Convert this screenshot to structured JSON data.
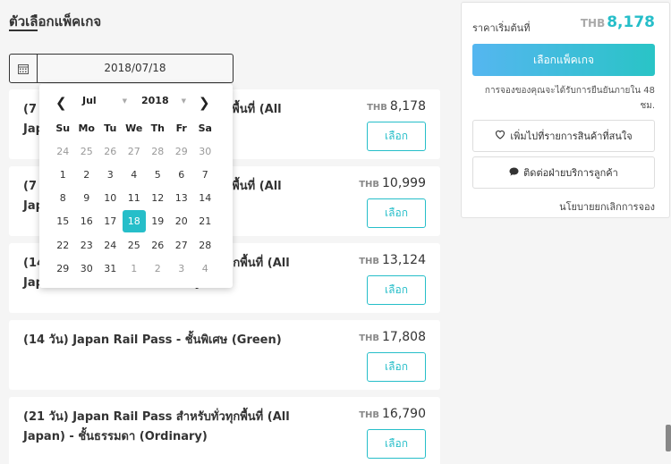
{
  "page": {
    "section_title": "ตัวเลือกแพ็คเกจ",
    "selected_date": "2018/07/18"
  },
  "calendar": {
    "month": "Jul",
    "year": "2018",
    "weekdays": [
      "Su",
      "Mo",
      "Tu",
      "We",
      "Th",
      "Fr",
      "Sa"
    ],
    "weeks": [
      [
        {
          "d": "24",
          "m": true
        },
        {
          "d": "25",
          "m": true
        },
        {
          "d": "26",
          "m": true
        },
        {
          "d": "27",
          "m": true
        },
        {
          "d": "28",
          "m": true
        },
        {
          "d": "29",
          "m": true
        },
        {
          "d": "30",
          "m": true
        }
      ],
      [
        {
          "d": "1"
        },
        {
          "d": "2"
        },
        {
          "d": "3"
        },
        {
          "d": "4"
        },
        {
          "d": "5"
        },
        {
          "d": "6"
        },
        {
          "d": "7"
        }
      ],
      [
        {
          "d": "8"
        },
        {
          "d": "9"
        },
        {
          "d": "10"
        },
        {
          "d": "11"
        },
        {
          "d": "12"
        },
        {
          "d": "13"
        },
        {
          "d": "14"
        }
      ],
      [
        {
          "d": "15"
        },
        {
          "d": "16"
        },
        {
          "d": "17"
        },
        {
          "d": "18",
          "s": true
        },
        {
          "d": "19"
        },
        {
          "d": "20"
        },
        {
          "d": "21"
        }
      ],
      [
        {
          "d": "22"
        },
        {
          "d": "23"
        },
        {
          "d": "24"
        },
        {
          "d": "25"
        },
        {
          "d": "26"
        },
        {
          "d": "27"
        },
        {
          "d": "28"
        }
      ],
      [
        {
          "d": "29"
        },
        {
          "d": "30"
        },
        {
          "d": "31"
        },
        {
          "d": "1",
          "m": true
        },
        {
          "d": "2",
          "m": true
        },
        {
          "d": "3",
          "m": true
        },
        {
          "d": "4",
          "m": true
        }
      ]
    ]
  },
  "packages": [
    {
      "name": "(7 วัน) Japan Rail Pass สำหรับทั่วทุกพื้นที่ (All Japan) - ชั้นธรรมดา (Ordinary)",
      "currency": "THB",
      "price": "8,178",
      "button": "เลือก"
    },
    {
      "name": "(7 วัน) Japan Rail Pass สำหรับทั่วทุกพื้นที่ (All Japan) - ชั้นพิเศษ (Green)",
      "currency": "THB",
      "price": "10,999",
      "button": "เลือก"
    },
    {
      "name": "(14 วัน) Japan Rail Pass สำหรับทั่วทุกพื้นที่ (All Japan) - ชั้นธรรมดา (Ordinary)",
      "currency": "THB",
      "price": "13,124",
      "button": "เลือก"
    },
    {
      "name": "(14 วัน) Japan Rail Pass - ชั้นพิเศษ (Green)",
      "currency": "THB",
      "price": "17,808",
      "button": "เลือก"
    },
    {
      "name": "(21 วัน) Japan Rail Pass สำหรับทั่วทุกพื้นที่ (All Japan) - ชั้นธรรมดา (Ordinary)",
      "currency": "THB",
      "price": "16,790",
      "button": "เลือก"
    }
  ],
  "sidebar": {
    "price_label": "ราคาเริ่มต้นที่",
    "currency": "THB",
    "price": "8,178",
    "select_button": "เลือกแพ็คเกจ",
    "confirm_note": "การจองของคุณจะได้รับการยืนยันภายใน 48 ชม.",
    "wishlist_button": "เพิ่มไปที่รายการสินค้าที่สนใจ",
    "contact_button": "ติดต่อฝ่ายบริการลูกค้า",
    "cancel_policy_link": "นโยบายยกเลิกการจอง"
  },
  "colors": {
    "accent": "#26bec9",
    "gradient_start": "#55b6f0",
    "gradient_end": "#29c4c6"
  }
}
